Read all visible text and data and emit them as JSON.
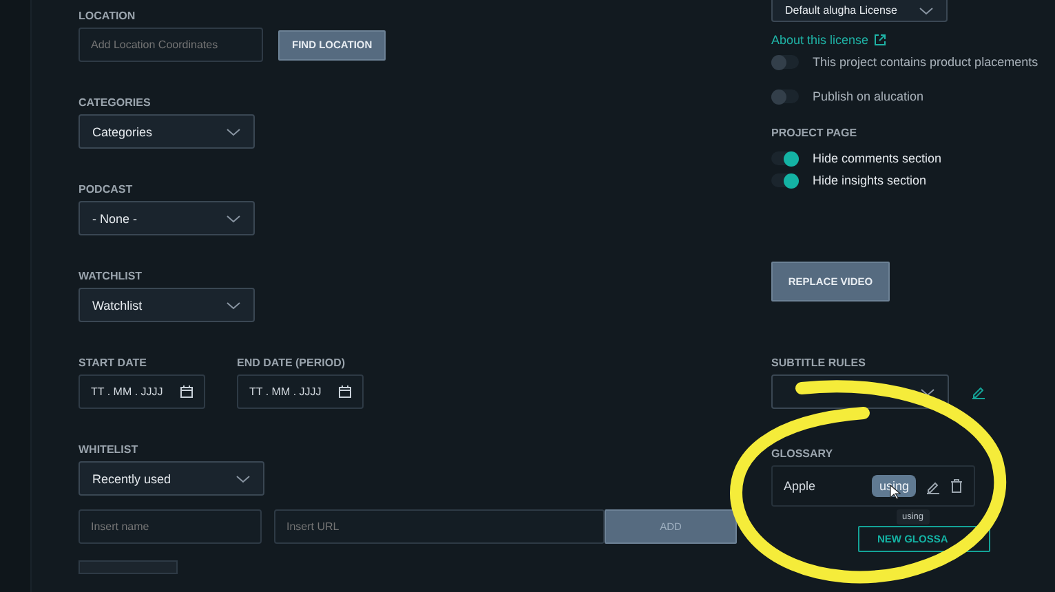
{
  "left": [
    {
      "kind": "location",
      "label": "LOCATION",
      "placeholder": "Add Location Coordinates",
      "button": "FIND LOCATION"
    },
    {
      "kind": "select",
      "label": "CATEGORIES",
      "value": "Categories"
    },
    {
      "kind": "select",
      "label": "PODCAST",
      "value": "- None -"
    },
    {
      "kind": "select",
      "label": "WATCHLIST",
      "value": "Watchlist"
    },
    {
      "kind": "dates",
      "dates": [
        {
          "label": "START DATE",
          "placeholder": "TT . MM . JJJJ"
        },
        {
          "label": "END DATE (PERIOD)",
          "placeholder": "TT . MM . JJJJ"
        }
      ]
    },
    {
      "kind": "whitelist",
      "label": "WHITELIST",
      "value": "Recently used",
      "name_placeholder": "Insert name",
      "url_placeholder": "Insert URL",
      "button": "ADD"
    }
  ],
  "right": {
    "license": "Default alugha License",
    "license_link": "About this license",
    "toggles": [
      {
        "label": "This project contains product placements",
        "on": false
      },
      {
        "label": "Publish on alucation",
        "on": false
      }
    ],
    "project_page": {
      "title": "PROJECT PAGE",
      "toggles": [
        {
          "label": "Hide comments section",
          "on": true
        },
        {
          "label": "Hide insights section",
          "on": true
        }
      ]
    },
    "replace_button": "REPLACE VIDEO",
    "subtitle_rules": {
      "label": "SUBTITLE RULES"
    },
    "glossary": {
      "label": "GLOSSARY",
      "items": [
        {
          "name": "Apple",
          "badge": "using",
          "tooltip": "using"
        }
      ],
      "button": "NEW GLOSSA"
    }
  }
}
